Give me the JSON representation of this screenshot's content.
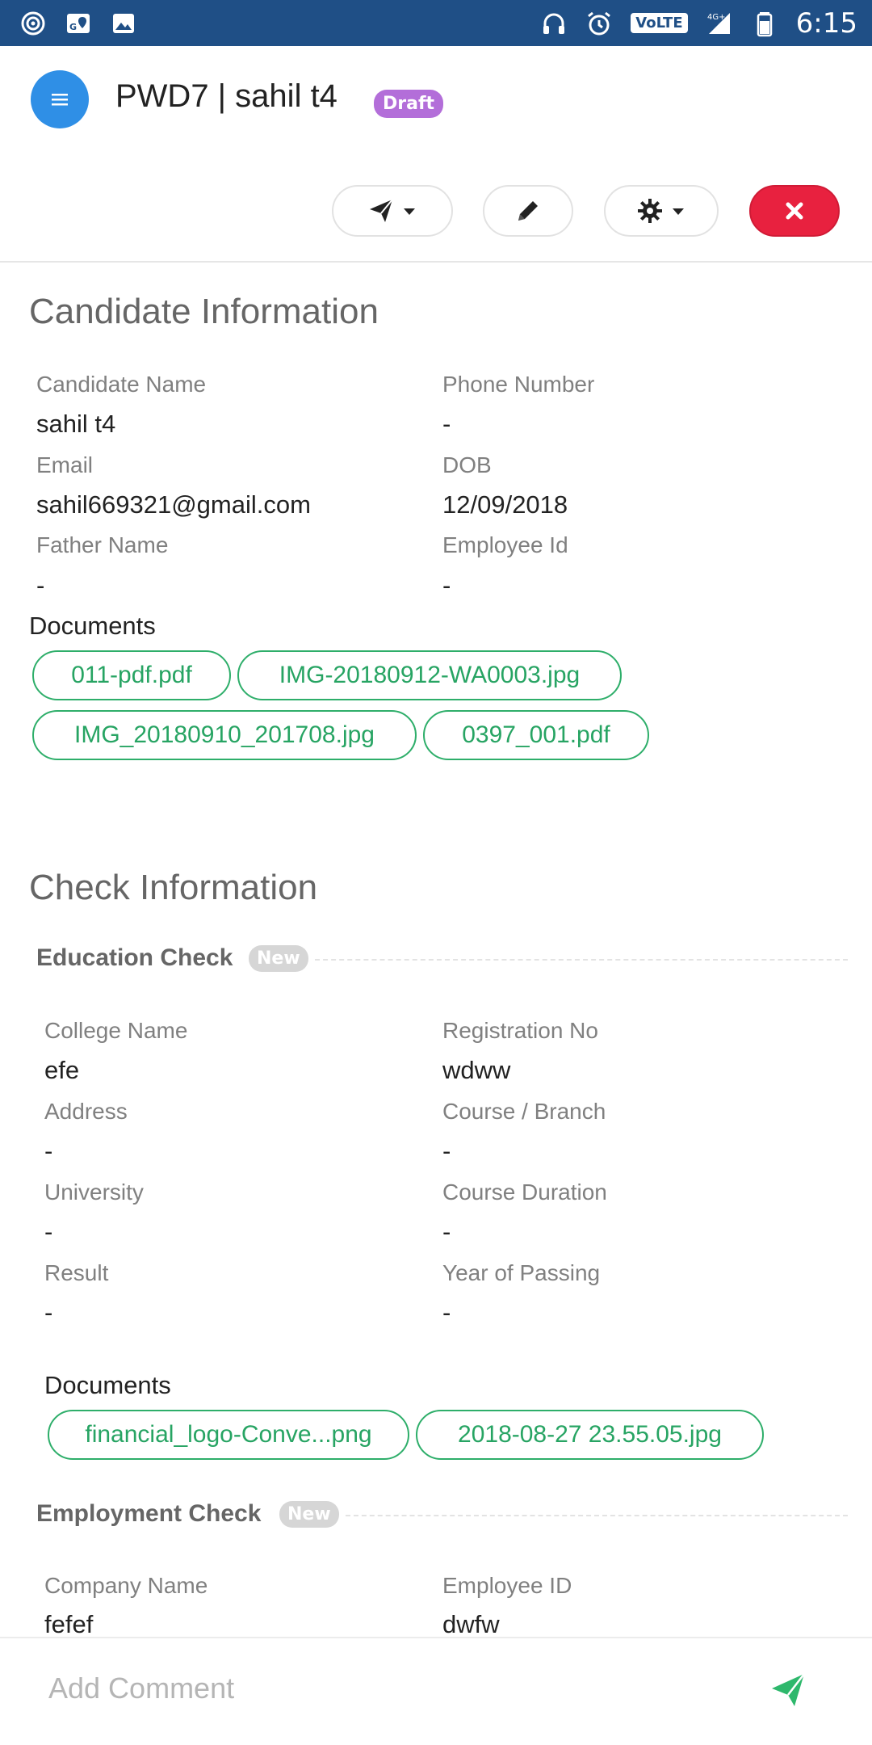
{
  "status_bar": {
    "time": "6:15",
    "volte": "VoLTE",
    "network": "4G+"
  },
  "header": {
    "title": "PWD7 | sahil t4",
    "status_badge": "Draft",
    "colors": {
      "menu": "#2f8fe6",
      "draft": "#b36ed9",
      "close": "#e8213f"
    }
  },
  "toolbar": {
    "send_icon": "paper-plane-icon",
    "edit_icon": "pencil-icon",
    "settings_icon": "gear-icon",
    "close_icon": "close-icon"
  },
  "candidate": {
    "section_title": "Candidate Information",
    "fields": [
      {
        "label": "Candidate Name",
        "value": "sahil t4"
      },
      {
        "label": "Phone Number",
        "value": "-"
      },
      {
        "label": "Email",
        "value": "sahil669321@gmail.com"
      },
      {
        "label": "DOB",
        "value": "12/09/2018"
      },
      {
        "label": "Father Name",
        "value": "-"
      },
      {
        "label": "Employee Id",
        "value": "-"
      }
    ],
    "documents_label": "Documents",
    "documents": [
      "011-pdf.pdf",
      "IMG-20180912-WA0003.jpg",
      "IMG_20180910_201708.jpg",
      "0397_001.pdf"
    ]
  },
  "checks": {
    "section_title": "Check Information",
    "education": {
      "title": "Education Check",
      "badge": "New",
      "fields": [
        {
          "label": "College Name",
          "value": "efe"
        },
        {
          "label": "Registration No",
          "value": "wdww"
        },
        {
          "label": "Address",
          "value": "-"
        },
        {
          "label": "Course / Branch",
          "value": "-"
        },
        {
          "label": "University",
          "value": "-"
        },
        {
          "label": "Course Duration",
          "value": "-"
        },
        {
          "label": "Result",
          "value": "-"
        },
        {
          "label": "Year of Passing",
          "value": "-"
        }
      ],
      "documents_label": "Documents",
      "documents": [
        "financial_logo-Conve...png",
        "2018-08-27 23.55.05.jpg"
      ]
    },
    "employment": {
      "title": "Employment Check",
      "badge": "New",
      "fields": [
        {
          "label": "Company Name",
          "value": "fefef"
        },
        {
          "label": "Employee ID",
          "value": "dwfw"
        }
      ]
    }
  },
  "comment": {
    "placeholder": "Add Comment",
    "send_color": "#2eb86c"
  }
}
